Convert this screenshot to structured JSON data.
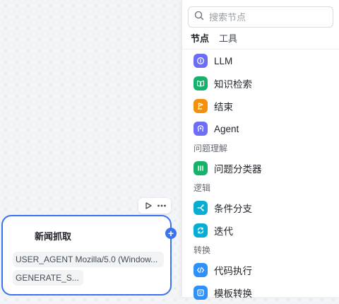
{
  "node": {
    "title": "新闻抓取",
    "fields": [
      "USER_AGENT Mozilla/5.0 (Window...",
      "GENERATE_S..."
    ],
    "run_icon": "play-icon",
    "more_icon": "more-icon",
    "add_label": "+"
  },
  "panel": {
    "search": {
      "placeholder": "搜索节点"
    },
    "tabs": [
      {
        "label": "节点"
      },
      {
        "label": "工具"
      }
    ],
    "items": [
      {
        "label": "LLM",
        "icon": "llm-icon",
        "color": "#6c6ef5"
      },
      {
        "label": "知识检索",
        "icon": "book-icon",
        "color": "#17b26a"
      },
      {
        "label": "结束",
        "icon": "end-icon",
        "color": "#f79009"
      },
      {
        "label": "Agent",
        "icon": "agent-icon",
        "color": "#6c6ef5"
      }
    ],
    "groups": [
      {
        "label": "问题理解",
        "items": [
          {
            "label": "问题分类器",
            "icon": "classifier-icon",
            "color": "#17b26a"
          }
        ]
      },
      {
        "label": "逻辑",
        "items": [
          {
            "label": "条件分支",
            "icon": "branch-icon",
            "color": "#06aed4"
          },
          {
            "label": "迭代",
            "icon": "iteration-icon",
            "color": "#06aed4"
          }
        ]
      },
      {
        "label": "转换",
        "items": [
          {
            "label": "代码执行",
            "icon": "code-icon",
            "color": "#2e90fa"
          },
          {
            "label": "模板转换",
            "icon": "template-icon",
            "color": "#2e90fa"
          }
        ]
      }
    ]
  }
}
